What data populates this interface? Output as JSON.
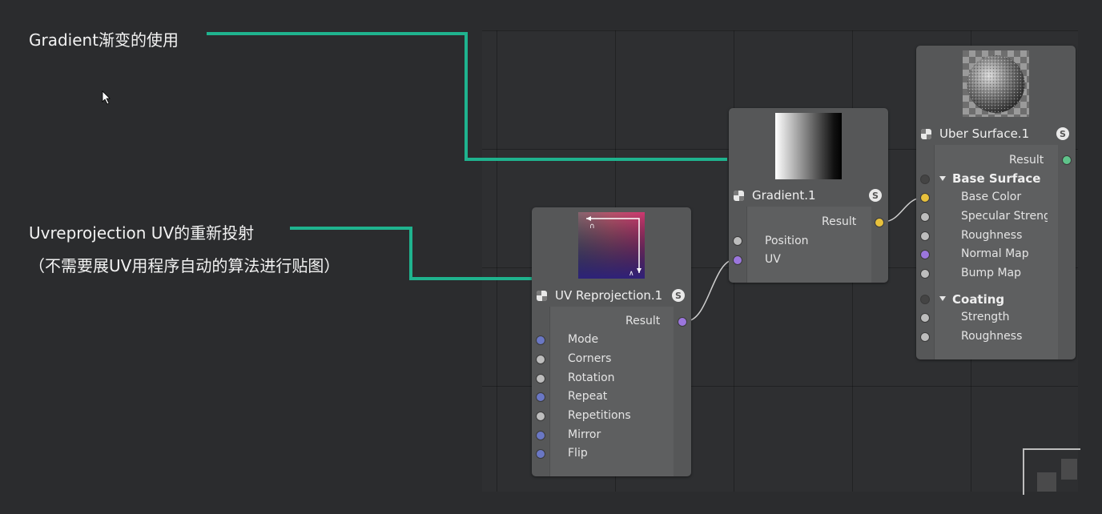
{
  "annotations": {
    "gradient_note": "Gradient渐变的使用",
    "uvreprojection_note": "Uvreprojection UV的重新投射",
    "uvreprojection_sub": "（不需要展UV用程序自动的算法进行贴图）"
  },
  "colors": {
    "annotation_line": "#1fb38e",
    "port_white": "#bdbdbd",
    "port_purple": "#9b76dd",
    "port_yellow": "#e8c13c",
    "port_blue": "#6a77c4",
    "port_green": "#5fc38a"
  },
  "nodes": {
    "uv_reprojection": {
      "title": "UV Reprojection.1",
      "solo": "S",
      "output": "Result",
      "inputs": [
        "Mode",
        "Corners",
        "Rotation",
        "Repeat",
        "Repetitions",
        "Mirror",
        "Flip"
      ],
      "preview_arrows": [
        "∩",
        "∧"
      ]
    },
    "gradient": {
      "title": "Gradient.1",
      "solo": "S",
      "output": "Result",
      "inputs": [
        "Position",
        "UV"
      ]
    },
    "uber_surface": {
      "title": "Uber Surface.1",
      "solo": "S",
      "output": "Result",
      "base_surface": {
        "label": "Base Surface",
        "inputs": [
          "Base Color",
          "Specular Strength",
          "Roughness",
          "Normal Map",
          "Bump Map"
        ]
      },
      "coating": {
        "label": "Coating",
        "inputs": [
          "Strength",
          "Roughness"
        ]
      }
    }
  },
  "icons": [
    "cursor-icon",
    "node-icon",
    "solo-icon",
    "collapse-triangle-icon"
  ]
}
